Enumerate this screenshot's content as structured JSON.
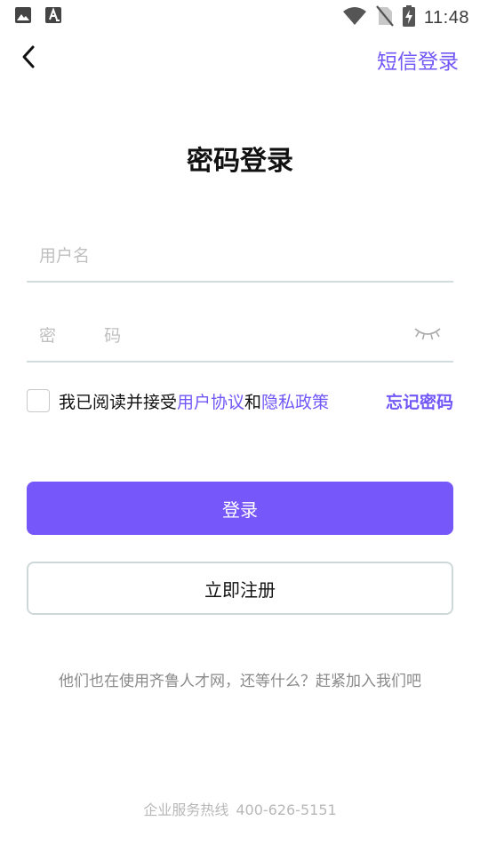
{
  "status_bar": {
    "time": "11:48",
    "icons": [
      "image-icon",
      "text-a-icon",
      "wifi-icon",
      "no-sim-icon",
      "battery-charging-icon"
    ]
  },
  "header": {
    "back_icon": "chevron-left-icon",
    "sms_login_label": "短信登录"
  },
  "title": "密码登录",
  "form": {
    "username": {
      "placeholder": "用户名",
      "value": ""
    },
    "password": {
      "placeholder": "密  码",
      "value": "",
      "toggle_icon": "eye-closed-icon"
    }
  },
  "agreement": {
    "checked": false,
    "prefix": "我已阅读并接受",
    "user_agreement": "用户协议",
    "conjunction": "和",
    "privacy_policy": "隐私政策",
    "forgot_password": "忘记密码"
  },
  "buttons": {
    "login": "登录",
    "register": "立即注册"
  },
  "slogan": "他们也在使用齐鲁人才网，还等什么？赶紧加入我们吧",
  "footer": {
    "hotline_label": "企业服务热线",
    "hotline_number": "400-626-5151"
  },
  "colors": {
    "accent": "#7257f6",
    "button": "#7657fa",
    "divider": "#d3dcdc"
  }
}
